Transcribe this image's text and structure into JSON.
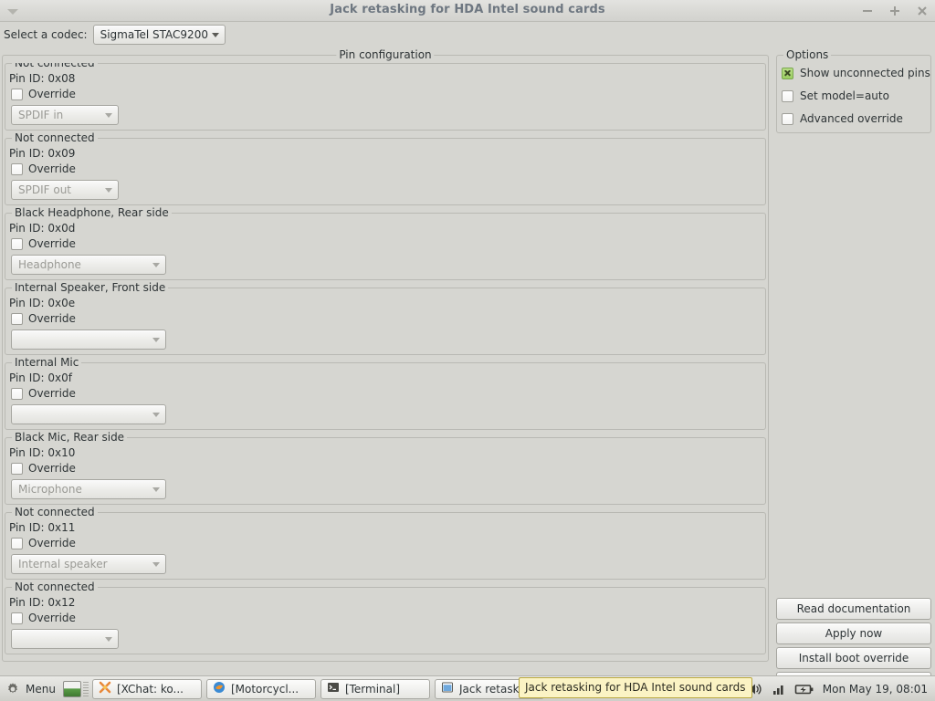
{
  "window": {
    "title": "Jack retasking for HDA Intel sound cards",
    "menu_icon": "window-menu-triangle-icon",
    "minimize_label": "−",
    "maximize_label": "+",
    "close_label": "×"
  },
  "codec": {
    "label": "Select a codec:",
    "selected": "SigmaTel STAC9200"
  },
  "pin_configuration": {
    "frame_label": "Pin configuration",
    "override_label": "Override",
    "pins": [
      {
        "group_label": "Not connected",
        "pin_id": "Pin ID: 0x08",
        "override_checked": false,
        "combo_value": "SPDIF in",
        "combo_width": 118,
        "combo_disabled": true
      },
      {
        "group_label": "Not connected",
        "pin_id": "Pin ID: 0x09",
        "override_checked": false,
        "combo_value": "SPDIF out",
        "combo_width": 118,
        "combo_disabled": true
      },
      {
        "group_label": "Black Headphone, Rear side",
        "pin_id": "Pin ID: 0x0d",
        "override_checked": false,
        "combo_value": "Headphone",
        "combo_width": 170,
        "combo_disabled": true
      },
      {
        "group_label": "Internal Speaker, Front side",
        "pin_id": "Pin ID: 0x0e",
        "override_checked": false,
        "combo_value": "",
        "combo_width": 170,
        "combo_disabled": true
      },
      {
        "group_label": "Internal Mic",
        "pin_id": "Pin ID: 0x0f",
        "override_checked": false,
        "combo_value": "",
        "combo_width": 170,
        "combo_disabled": true
      },
      {
        "group_label": "Black Mic, Rear side",
        "pin_id": "Pin ID: 0x10",
        "override_checked": false,
        "combo_value": "Microphone",
        "combo_width": 170,
        "combo_disabled": true
      },
      {
        "group_label": "Not connected",
        "pin_id": "Pin ID: 0x11",
        "override_checked": false,
        "combo_value": "Internal speaker",
        "combo_width": 170,
        "combo_disabled": true
      },
      {
        "group_label": "Not connected",
        "pin_id": "Pin ID: 0x12",
        "override_checked": false,
        "combo_value": "",
        "combo_width": 118,
        "combo_disabled": true
      }
    ]
  },
  "options": {
    "frame_label": "Options",
    "items": [
      {
        "label": "Show unconnected pins",
        "checked": true
      },
      {
        "label": "Set model=auto",
        "checked": false
      },
      {
        "label": "Advanced override",
        "checked": false
      }
    ]
  },
  "actions": {
    "read_documentation": "Read documentation",
    "apply_now": "Apply now",
    "install_boot_override": "Install boot override",
    "fourth_partial": ""
  },
  "taskbar": {
    "menu_label": "Menu",
    "menu_icon": "gear-icon",
    "show_desktop_icon": "show-desktop-icon",
    "windows": [
      {
        "label": "[XChat: ko...",
        "icon": "xchat-icon"
      },
      {
        "label": "[Motorcycl...",
        "icon": "firefox-icon"
      },
      {
        "label": "[Terminal]",
        "icon": "terminal-icon"
      },
      {
        "label": "Jack retask",
        "icon": "window-icon"
      }
    ],
    "tray": [
      "volume-icon",
      "signal-icon",
      "battery-charging-icon"
    ],
    "clock": "Mon May 19, 08:01",
    "tooltip": "Jack retasking for HDA Intel sound cards"
  },
  "colors": {
    "background": "#d6d6d1",
    "title_text": "#6e7781",
    "checkbox_checked": "#9ccd62",
    "tooltip_bg": "#fbf3c4"
  }
}
